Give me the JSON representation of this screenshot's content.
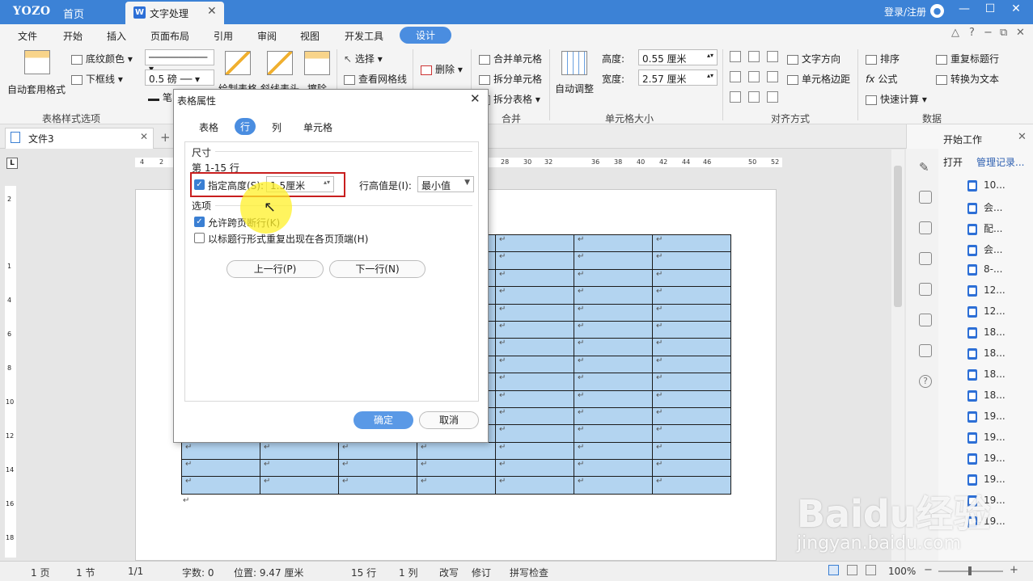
{
  "app": {
    "logo": "YOZO",
    "home": "首页",
    "doc_tab": "文字处理",
    "login": "登录/注册"
  },
  "menu": {
    "items": [
      "文件",
      "开始",
      "插入",
      "页面布局",
      "引用",
      "审阅",
      "视图",
      "开发工具"
    ],
    "active": "设计"
  },
  "ribbon": {
    "auto_format": "自动套用格式",
    "shading": "底纹颜色",
    "bottom_border": "下框线",
    "line_weight": "0.5",
    "line_unit": "磅",
    "pen": "笔",
    "draw_table": "绘制表格",
    "diagonal_header": "斜线表头",
    "erase": "擦除",
    "select": "选择",
    "view_gridlines": "查看网格线",
    "delete": "删除",
    "merge_cells": "合并单元格",
    "split_cells": "拆分单元格",
    "split_table": "拆分表格",
    "auto_fit": "自动调整",
    "height_label": "高度:",
    "height_value": "0.55 厘米",
    "width_label": "宽度:",
    "width_value": "2.57 厘米",
    "text_direction": "文字方向",
    "cell_margin": "单元格边距",
    "sort": "排序",
    "formula": "公式",
    "quick_calc": "快速计算",
    "repeat_header": "重复标题行",
    "to_text": "转换为文本",
    "group_style": "表格样式选项",
    "group_merge": "合并",
    "group_cellsize": "单元格大小",
    "group_align": "对齐方式",
    "group_data": "数据"
  },
  "doc": {
    "tab": "文件3",
    "ruler": [
      "4",
      "2",
      "28",
      "30",
      "32",
      "36",
      "38",
      "40",
      "42",
      "44",
      "46",
      "50",
      "52"
    ],
    "vruler": [
      "2",
      "1",
      "4",
      "6",
      "8",
      "10",
      "12",
      "14",
      "16",
      "18"
    ]
  },
  "table": {
    "rows": 15,
    "cols": 7,
    "cell": "↵"
  },
  "dialog": {
    "title": "表格属性",
    "tabs": [
      "表格",
      "行",
      "列",
      "单元格"
    ],
    "active_tab": "行",
    "section_size": "尺寸",
    "rows_label": "第 1-15 行",
    "specify_height": "指定高度(S):",
    "height_value": "1.5厘米",
    "height_is": "行高值是(I):",
    "height_mode": "最小值",
    "section_options": "选项",
    "allow_break": "允许跨页断行(K)",
    "repeat_header": "以标题行形式重复出现在各页顶端(H)",
    "prev_row": "上一行(P)",
    "next_row": "下一行(N)",
    "ok": "确定",
    "cancel": "取消"
  },
  "side": {
    "title": "开始工作",
    "open": "打开",
    "manage": "管理记录...",
    "files": [
      "10...",
      "会...",
      "配...",
      "会...",
      "8-...",
      "12...",
      "12...",
      "18...",
      "18...",
      "18...",
      "18...",
      "19...",
      "19...",
      "19...",
      "19...",
      "19...",
      "19..."
    ]
  },
  "status": {
    "page": "1 页",
    "section": "1 节",
    "pages": "1/1",
    "words": "字数: 0",
    "position": "位置: 9.47 厘米",
    "row": "15 行",
    "col": "1 列",
    "overwrite": "改写",
    "revise": "修订",
    "spell": "拼写检查",
    "zoom": "100%"
  },
  "watermark": {
    "logo": "Baidu经验",
    "url": "jingyan.baidu.com"
  }
}
